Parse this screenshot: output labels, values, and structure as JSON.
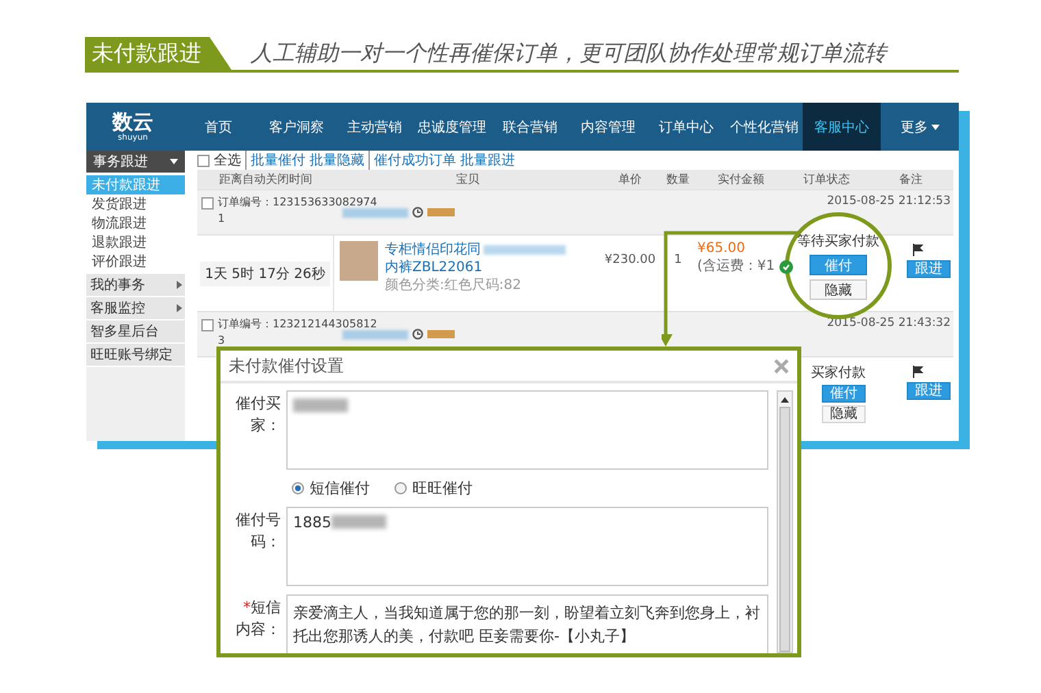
{
  "banner": {
    "tag": "未付款跟进",
    "slogan": "人工辅助一对一个性再催保订单，更可团队协作处理常规订单流转"
  },
  "app": {
    "logo": "数云",
    "logo_sub": "shuyun",
    "nav": [
      {
        "label": "首页",
        "selected": false,
        "dropdown": false
      },
      {
        "label": "客户洞察",
        "selected": false,
        "dropdown": false
      },
      {
        "label": "主动营销",
        "selected": false,
        "dropdown": false
      },
      {
        "label": "忠诚度管理",
        "selected": false,
        "dropdown": false
      },
      {
        "label": "联合营销",
        "selected": false,
        "dropdown": false
      },
      {
        "label": "内容管理",
        "selected": false,
        "dropdown": false
      },
      {
        "label": "订单中心",
        "selected": false,
        "dropdown": false
      },
      {
        "label": "个性化营销",
        "selected": false,
        "dropdown": false
      },
      {
        "label": "客服中心",
        "selected": true,
        "dropdown": false
      },
      {
        "label": "更多",
        "selected": false,
        "dropdown": true
      }
    ],
    "sidebar": {
      "title": "事务跟进",
      "items": [
        {
          "label": "未付款跟进",
          "selected": true
        },
        {
          "label": "发货跟进",
          "selected": false
        },
        {
          "label": "物流跟进",
          "selected": false
        },
        {
          "label": "退款跟进",
          "selected": false
        },
        {
          "label": "评价跟进",
          "selected": false
        }
      ],
      "groups": [
        {
          "label": "我的事务",
          "expandable": true
        },
        {
          "label": "客服监控",
          "expandable": true
        },
        {
          "label": "智多星后台",
          "expandable": false
        },
        {
          "label": "旺旺账号绑定",
          "expandable": false
        }
      ]
    },
    "toolbar": {
      "select_all": "全选",
      "checked": false,
      "groups": [
        [
          "批量催付",
          "批量隐藏"
        ],
        [
          "催付成功订单",
          "批量跟进"
        ]
      ]
    },
    "columns": [
      "距离自动关闭时间",
      "宝贝",
      "单价",
      "数量",
      "实付金额",
      "订单状态",
      "备注"
    ],
    "orders": [
      {
        "checked": false,
        "order_no": "订单编号：123153633082974",
        "index": "1",
        "buyer_redacted": true,
        "new_customer_tag": true,
        "time": "2015-08-25 21:12:53",
        "countdown": "1天 5时 17分 26秒",
        "product": {
          "title": "专柜情侣印花同",
          "title_redacted": true,
          "title_2": "内裤ZBL22061",
          "attrs": "颜色分类:红色尺码:82"
        },
        "price": "¥230.00",
        "qty": "1",
        "paid": "¥65.00",
        "shipping": "(含运费：¥1",
        "followup": "跟进"
      },
      {
        "checked": false,
        "order_no": "订单编号：123212144305812",
        "index": "3",
        "buyer_redacted": true,
        "new_customer_tag": true,
        "time": "2015-08-25 21:43:32",
        "status": "买家付款",
        "actions": [
          "催付",
          "隐藏"
        ],
        "followup": "跟进"
      }
    ]
  },
  "magnifier": {
    "status": "等待买家付款",
    "primary": "催付",
    "secondary": "隐藏"
  },
  "dialog": {
    "title": "未付款催付设置",
    "required_mark": "*",
    "fields": [
      {
        "kind": "textarea",
        "label": "催付买家：",
        "required": false,
        "redacted": true
      },
      {
        "kind": "radio",
        "options": [
          {
            "label": "短信催付",
            "selected": true
          },
          {
            "label": "旺旺催付",
            "selected": false
          }
        ]
      },
      {
        "kind": "textarea",
        "label": "催付号码：",
        "required": false,
        "value": "1885",
        "redacted": true
      },
      {
        "kind": "textarea",
        "label": "短信内容：",
        "required": true,
        "value": "亲爱滴主人，当我知道属于您的那一刻，盼望着立刻飞奔到您身上，衬托出您那诱人的美，付款吧 臣妾需要你-【小丸子】"
      }
    ]
  }
}
